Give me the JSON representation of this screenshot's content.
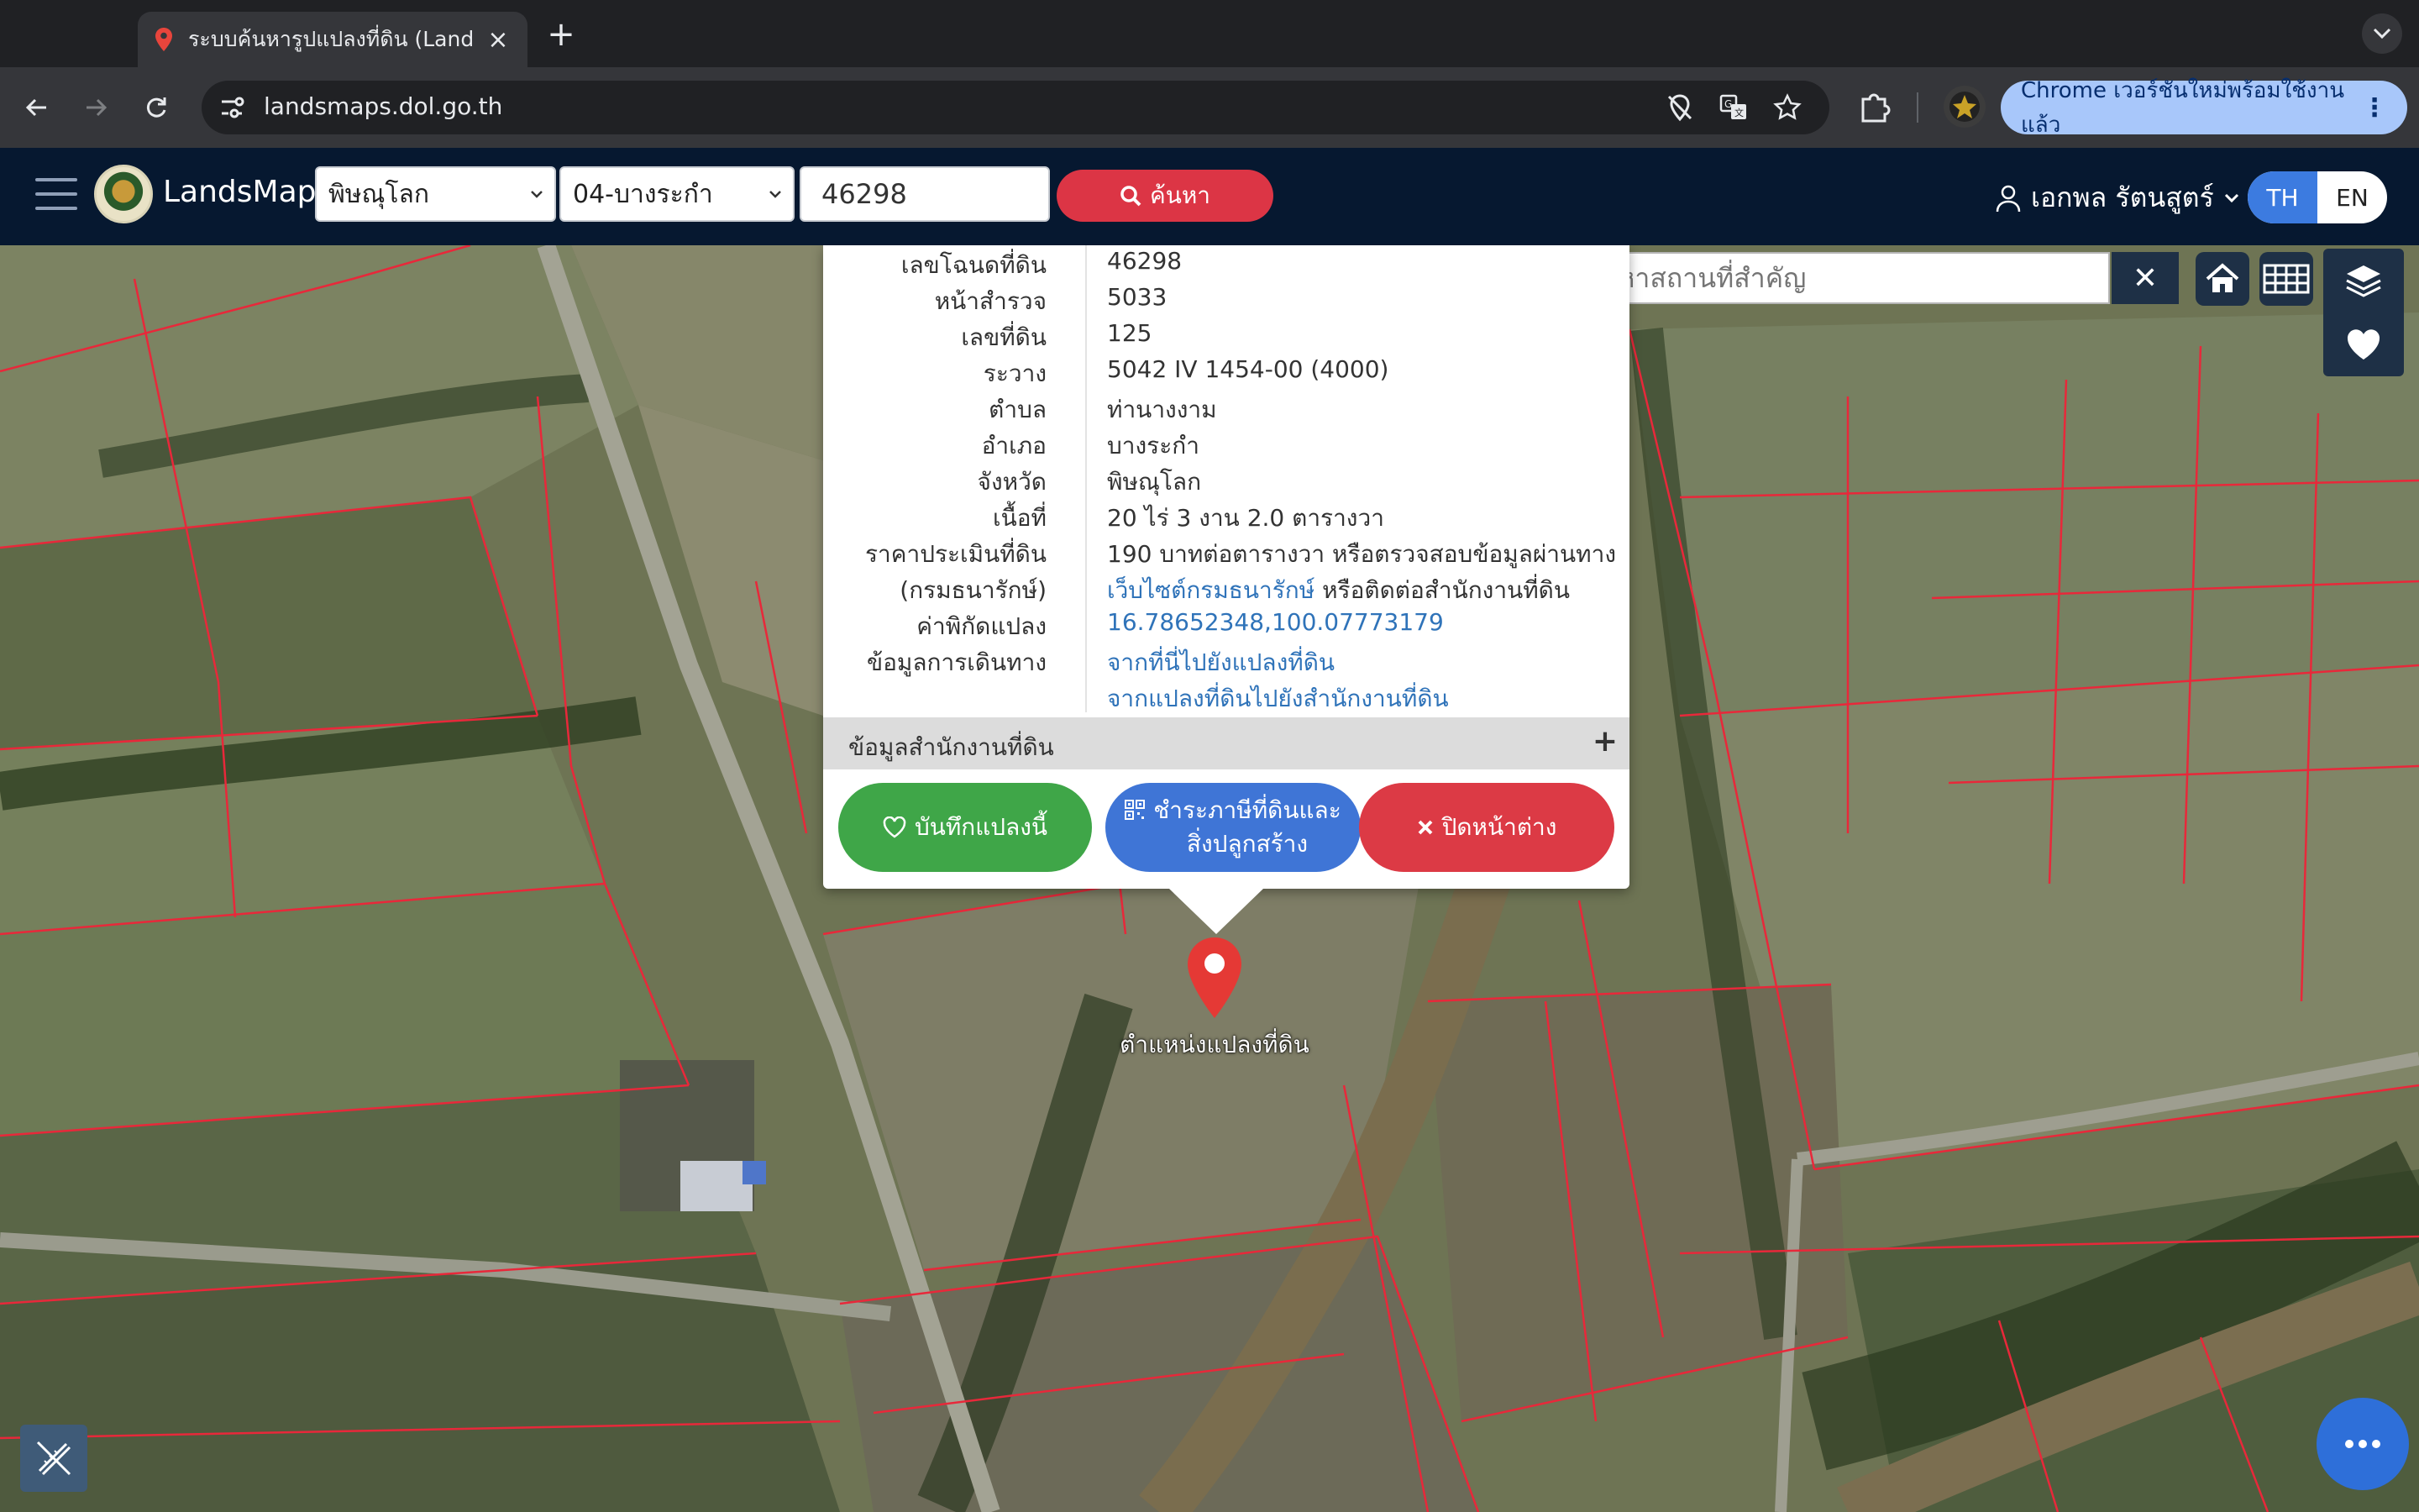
{
  "browser": {
    "tab_title": "ระบบค้นหารูปแปลงที่ดิน (LandsMaps)",
    "url": "landsmaps.dol.go.th",
    "update_label": "Chrome เวอร์ชันใหม่พร้อมใช้งานแล้ว"
  },
  "header": {
    "app_name": "LandsMaps",
    "province": "พิษณุโลก",
    "district": "04-บางระกำ",
    "deed_number": "46298",
    "search_label": "ค้นหา",
    "user_name": "เอกพล รัตนสูตร์",
    "lang_th": "TH",
    "lang_en": "EN"
  },
  "map": {
    "place_search_placeholder": "ค้นหาสถานที่สำคัญ",
    "pin_label": "ตำแหน่งแปลงที่ดิน"
  },
  "parcel_info": {
    "rows": [
      {
        "label": "เลขโฉนดที่ดิน",
        "value": "46298"
      },
      {
        "label": "หน้าสำรวจ",
        "value": "5033"
      },
      {
        "label": "เลขที่ดิน",
        "value": "125"
      },
      {
        "label": "ระวาง",
        "value": "5042 IV 1454-00 (4000)"
      },
      {
        "label": "ตำบล",
        "value": "ท่านางงาม"
      },
      {
        "label": "อำเภอ",
        "value": "บางระกำ"
      },
      {
        "label": "จังหวัด",
        "value": "พิษณุโลก"
      },
      {
        "label": "เนื้อที่",
        "value": "20 ไร่ 3 งาน 2.0 ตารางวา"
      },
      {
        "label": "ราคาประเมินที่ดิน",
        "value": "190 บาทต่อตารางวา หรือตรวจสอบข้อมูลผ่านทาง"
      },
      {
        "label": "(กรมธนารักษ์)",
        "link": "เว็บไซต์กรมธนารักษ์",
        "value": " หรือติดต่อสำนักงานที่ดิน"
      },
      {
        "label": "ค่าพิกัดแปลง",
        "link": "16.78652348,100.07773179"
      },
      {
        "label": "ข้อมูลการเดินทาง",
        "link": "จากที่นี่ไปยังแปลงที่ดิน"
      },
      {
        "label": "",
        "link": "จากแปลงที่ดินไปยังสำนักงานที่ดิน"
      }
    ],
    "office_section": "ข้อมูลสำนักงานที่ดิน",
    "office_expand": "+",
    "save_label": "บันทึกแปลงนี้",
    "tax_label_1": "ชำระภาษีที่ดินและ",
    "tax_label_2": "สิ่งปลูกสร้าง",
    "close_label": "ปิดหน้าต่าง"
  },
  "colors": {
    "header_bg": "#061830",
    "search_red": "#dc3545",
    "save_green": "#3fa648",
    "tax_blue": "#3f75d6",
    "parcel_line": "#e8283a"
  }
}
